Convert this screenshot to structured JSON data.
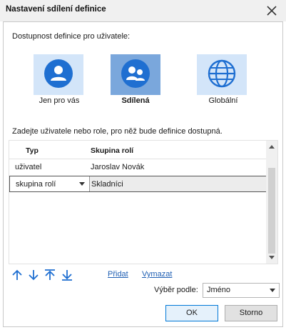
{
  "window": {
    "title": "Nastavení sdílení definice"
  },
  "availability": {
    "label": "Dostupnost definice pro uživatele:",
    "options": [
      {
        "label": "Jen pro vás",
        "icon": "person-icon",
        "selected": false
      },
      {
        "label": "Sdílená",
        "icon": "people-icon",
        "selected": true
      },
      {
        "label": "Globální",
        "icon": "globe-icon",
        "selected": false
      }
    ]
  },
  "users": {
    "instruction": "Zadejte uživatele nebo role, pro něž bude definice dostupná.",
    "columns": [
      "Typ",
      "Skupina rolí"
    ],
    "rows": [
      {
        "type": "uživatel",
        "name": "Jaroslav Novák"
      },
      {
        "type": "skupina rolí",
        "name": "Skladníci"
      }
    ]
  },
  "toolbar": {
    "move_buttons": [
      "move-up",
      "move-down",
      "move-top",
      "move-bottom"
    ],
    "add_label": "Přidat",
    "delete_label": "Vymazat"
  },
  "selection": {
    "label": "Výběr podle:",
    "value": "Jméno"
  },
  "buttons": {
    "ok": "OK",
    "cancel": "Storno"
  },
  "colors": {
    "accent": "#1f6fd1",
    "selected_option_bg": "#7aa7dc",
    "option_bg": "#d3e5f9",
    "link": "#1f5fb3"
  }
}
